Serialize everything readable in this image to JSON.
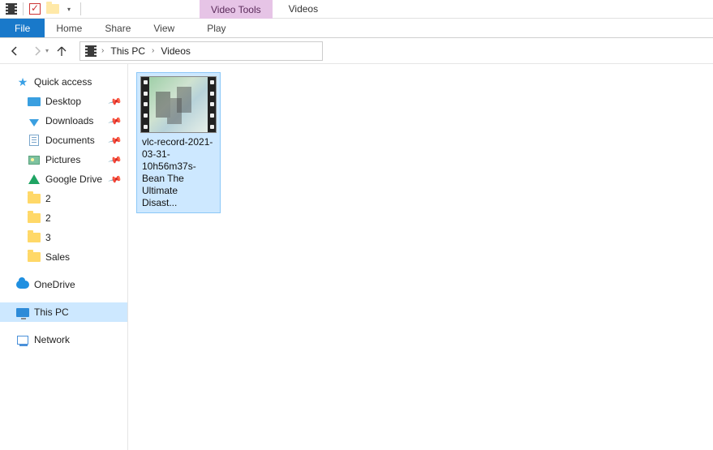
{
  "window": {
    "contextual_tab_label": "Video Tools",
    "location_title": "Videos"
  },
  "ribbon": {
    "file": "File",
    "home": "Home",
    "share": "Share",
    "view": "View",
    "play": "Play"
  },
  "navigation": {
    "back_enabled": true,
    "forward_enabled": false
  },
  "address": {
    "segments": [
      "This PC",
      "Videos"
    ]
  },
  "sidebar": {
    "quick_access": {
      "label": "Quick access"
    },
    "items": [
      {
        "label": "Desktop",
        "icon": "desktop",
        "pinned": true
      },
      {
        "label": "Downloads",
        "icon": "download",
        "pinned": true
      },
      {
        "label": "Documents",
        "icon": "document",
        "pinned": true
      },
      {
        "label": "Pictures",
        "icon": "picture",
        "pinned": true
      },
      {
        "label": "Google Drive",
        "icon": "gdrive",
        "pinned": true
      },
      {
        "label": "2",
        "icon": "folder",
        "pinned": false
      },
      {
        "label": "2",
        "icon": "folder",
        "pinned": false
      },
      {
        "label": "3",
        "icon": "folder",
        "pinned": false
      },
      {
        "label": "Sales",
        "icon": "folder",
        "pinned": false
      }
    ],
    "onedrive": {
      "label": "OneDrive"
    },
    "thispc": {
      "label": "This PC"
    },
    "network": {
      "label": "Network"
    }
  },
  "content": {
    "files": [
      {
        "name": "vlc-record-2021-03-31-10h56m37s-Bean The Ultimate Disast...",
        "selected": true
      }
    ]
  }
}
